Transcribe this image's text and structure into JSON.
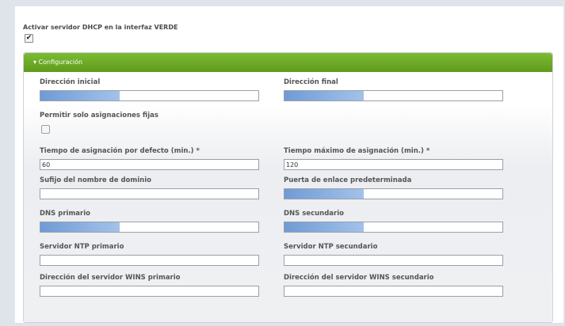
{
  "enable_dhcp": {
    "label": "Activar servidor DHCP en la interfaz VERDE",
    "checked_mark": "✔"
  },
  "panel": {
    "title": "Configuración",
    "toggle_icon": "▾"
  },
  "fields": {
    "start_address": {
      "label": "Dirección inicial",
      "value": ""
    },
    "end_address": {
      "label": "Dirección final",
      "value": ""
    },
    "fixed_only": {
      "label": "Permitir solo asignaciones fijas",
      "checked": false
    },
    "default_lease": {
      "label": "Tiempo de asignación por defecto (min.) *",
      "value": "60"
    },
    "max_lease": {
      "label": "Tiempo máximo de asignación (min.) *",
      "value": "120"
    },
    "domain_suffix": {
      "label": "Sufijo del nombre de dominio",
      "value": ""
    },
    "gateway": {
      "label": "Puerta de enlace predeterminada",
      "value": ""
    },
    "dns1": {
      "label": "DNS primario",
      "value": ""
    },
    "dns2": {
      "label": "DNS secundario",
      "value": ""
    },
    "ntp1": {
      "label": "Servidor NTP primario",
      "value": ""
    },
    "ntp2": {
      "label": "Servidor NTP secundario",
      "value": ""
    },
    "wins1": {
      "label": "Dirección del servidor WINS primario",
      "value": ""
    },
    "wins2": {
      "label": "Dirección del servidor WINS secundario",
      "value": ""
    }
  },
  "colors": {
    "panel_header": "#6aa82a",
    "redacted_fill": "#7fa7dd"
  }
}
